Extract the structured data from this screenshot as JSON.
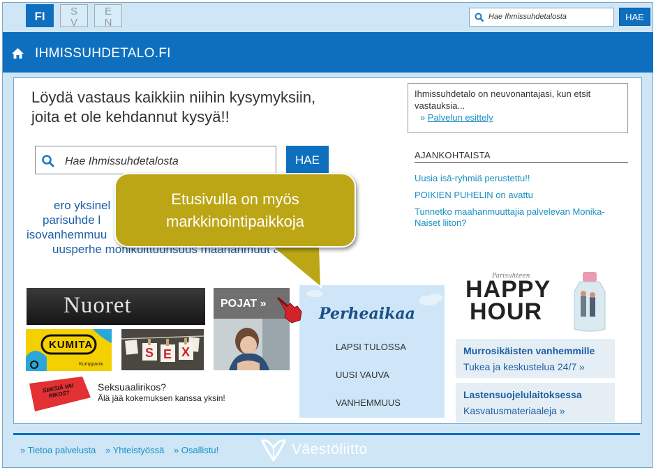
{
  "languages": [
    {
      "code": "FI",
      "active": true
    },
    {
      "code": "SV",
      "active": false
    },
    {
      "code": "EN",
      "active": false
    }
  ],
  "top_search": {
    "placeholder": "Hae Ihmissuhdetalosta",
    "button": "HAE"
  },
  "nav": {
    "home_icon": "home-icon",
    "site_title": "IHMISSUHDETALO.FI"
  },
  "main": {
    "headline_line1": "Löydä vastaus kaikkiin niihin kysymyksiin,",
    "headline_line2": "joita et ole kehdannut kysyä!!",
    "search": {
      "placeholder": "Hae Ihmissuhdetalosta",
      "button": "HAE"
    },
    "tags": [
      "ero  yksinel",
      "parisuhde  l",
      "isovanhemmuu",
      "uusperhe  monikulttuurisuus  maahanmuut  al"
    ]
  },
  "info_box": {
    "text": "Ihmissuhdetalo on neuvonantajasi, kun etsit vastauksia...",
    "link": "Palvelun esittely"
  },
  "news": {
    "title": "AJANKOHTAISTA",
    "items": [
      "Uusia isä-ryhmiä perustettu!!",
      "POIKIEN PUHELIN on avattu",
      "Tunnetko maahanmuuttajia palvelevan Monika-Naiset liiton?"
    ]
  },
  "banners": {
    "nuoret": "Nuoret",
    "pojat": "POJAT »",
    "kumita": "KUMITA",
    "kumita_small": "Kumppaniv",
    "sex_letters": [
      "S",
      "E",
      "X"
    ],
    "perheaikaa": {
      "logo": "Perheaikaa",
      "items": [
        "LAPSI TULOSSA",
        "UUSI VAUVA",
        "VANHEMMUUS"
      ]
    },
    "happy_hour": {
      "script": "Parisuhteen",
      "line1": "HAPPY",
      "line2": "HOUR"
    },
    "seksi_badge": "SEKSIÄ VAI RIKOS?",
    "seksi_title": "Seksuaalirikos?",
    "seksi_sub": "Älä jää kokemuksen kanssa yksin!"
  },
  "side_boxes": [
    {
      "title": "Murrosikäisten vanhemmille",
      "link": "Tukea ja keskustelua 24/7 »"
    },
    {
      "title": "Lastensuojelulaitoksessa",
      "link": "Kasvatusmateriaaleja »"
    }
  ],
  "callout": {
    "line1": "Etusivulla on myös",
    "line2": "markkinointipaikkoja",
    "color": "#bca615"
  },
  "footer": {
    "links": [
      "» Tietoa palvelusta",
      "» Yhteistyössä",
      "» Osallistu!"
    ],
    "brand": "Väestöliitto"
  },
  "colors": {
    "primary": "#0e6fbf",
    "link": "#1a8fc4",
    "background": "#cfe6f6"
  }
}
